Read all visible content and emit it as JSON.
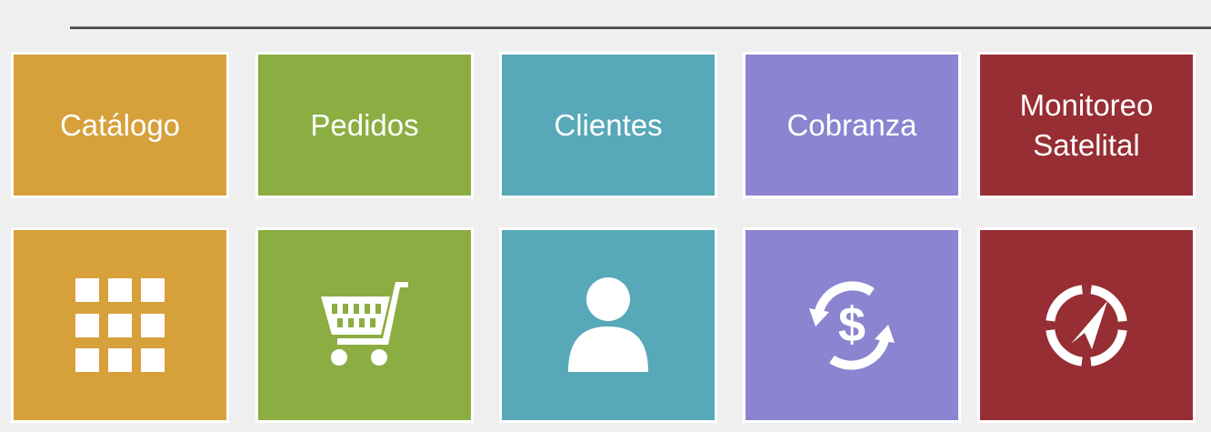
{
  "tiles": [
    {
      "label": "Catálogo",
      "color": "#d6a03a",
      "icon": "grid-icon"
    },
    {
      "label": "Pedidos",
      "color": "#8bad42",
      "icon": "shopping-cart-icon"
    },
    {
      "label": "Clientes",
      "color": "#57a8b8",
      "icon": "user-icon"
    },
    {
      "label": "Cobranza",
      "color": "#8b84d0",
      "icon": "dollar-cycle-icon"
    },
    {
      "label": "Monitoreo Satelital",
      "color": "#962e33",
      "icon": "compass-icon"
    }
  ]
}
